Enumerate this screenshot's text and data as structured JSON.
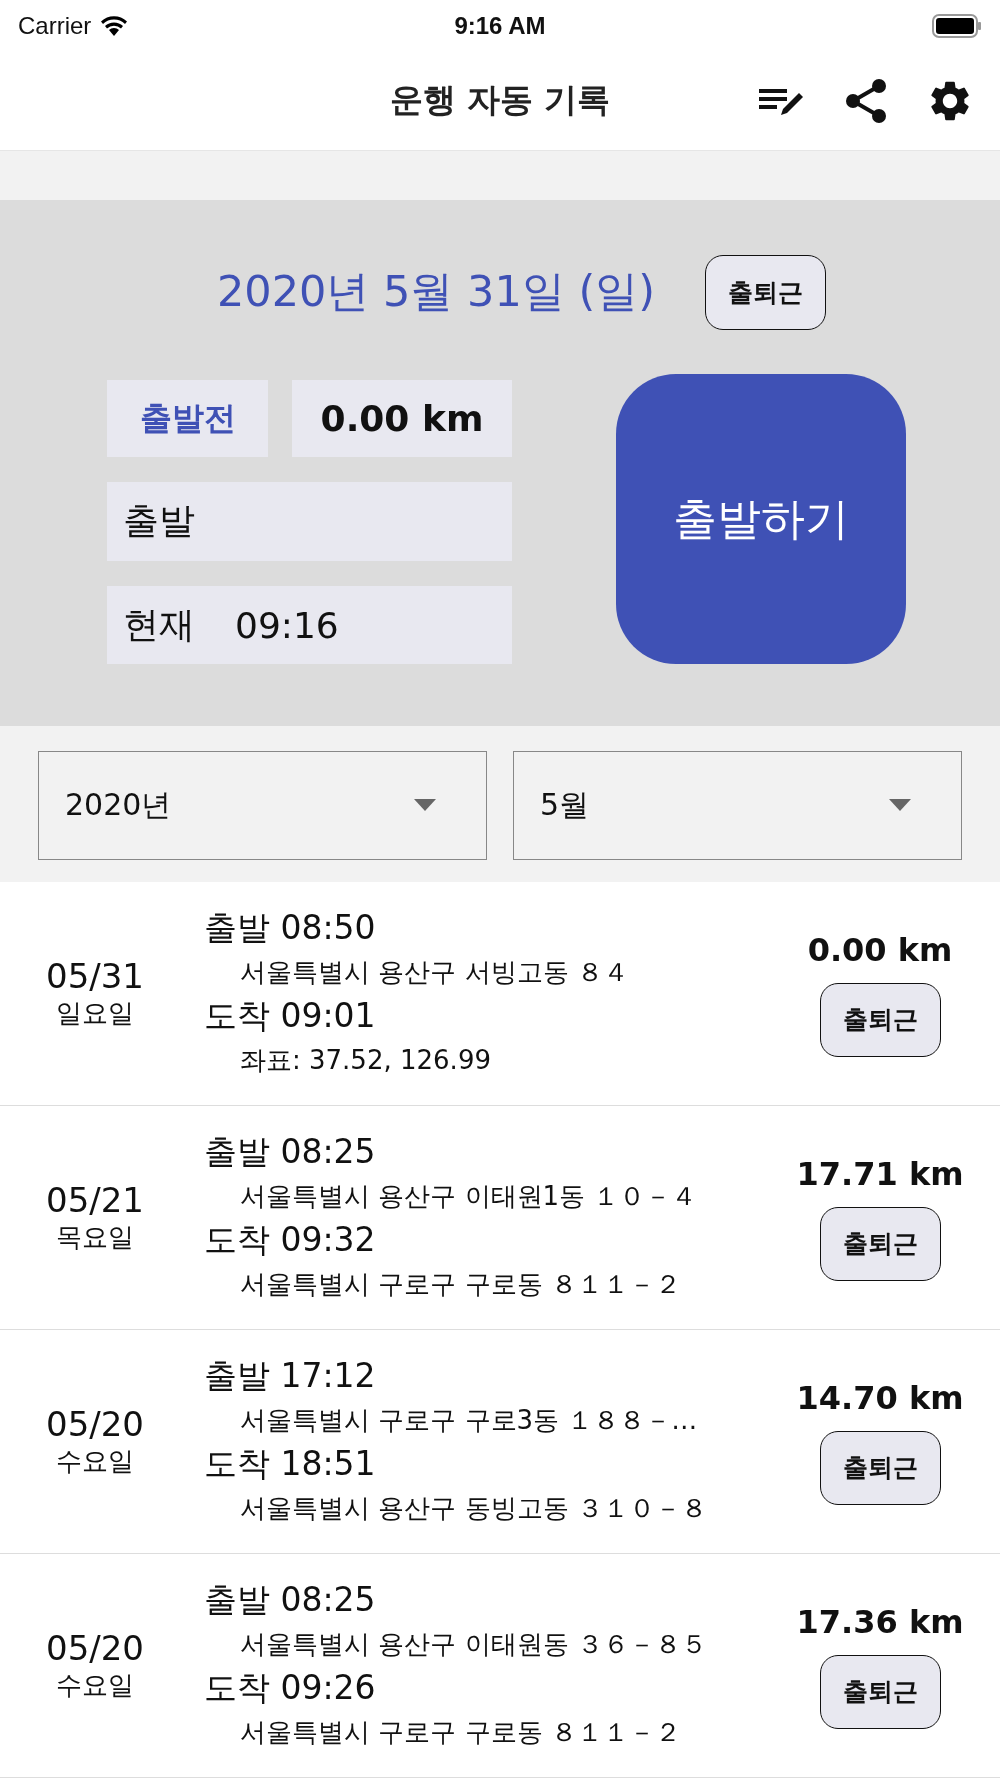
{
  "status_bar": {
    "carrier": "Carrier",
    "time": "9:16 AM"
  },
  "nav": {
    "title": "운행 자동 기록"
  },
  "today": {
    "date": "2020년 5월 31일 (일)",
    "category": "출퇴근",
    "state": "출발전",
    "distance": "0.00 km",
    "departure": "출발",
    "current_label": "현재",
    "current_time": "09:16",
    "start_button": "출발하기"
  },
  "filters": [
    {
      "value": "2020년"
    },
    {
      "value": "5월"
    }
  ],
  "trips": [
    {
      "date": "05/31",
      "weekday": "일요일",
      "depart": "출발 08:50",
      "depart_place": "서울특별시 용산구 서빙고동 ８４",
      "arrive": "도착 09:01",
      "arrive_place": "좌표: 37.52, 126.99",
      "distance": "0.00 km",
      "category": "출퇴근"
    },
    {
      "date": "05/21",
      "weekday": "목요일",
      "depart": "출발 08:25",
      "depart_place": "서울특별시 용산구 이태원1동 １０－４",
      "arrive": "도착 09:32",
      "arrive_place": "서울특별시 구로구 구로동 ８１１－２",
      "distance": "17.71 km",
      "category": "출퇴근"
    },
    {
      "date": "05/20",
      "weekday": "수요일",
      "depart": "출발 17:12",
      "depart_place": "서울특별시 구로구 구로3동 １８８－…",
      "arrive": "도착 18:51",
      "arrive_place": "서울특별시 용산구 동빙고동 ３１０－８",
      "distance": "14.70 km",
      "category": "출퇴근"
    },
    {
      "date": "05/20",
      "weekday": "수요일",
      "depart": "출발 08:25",
      "depart_place": "서울특별시 용산구 이태원동 ３６－８５",
      "arrive": "도착 09:26",
      "arrive_place": "서울특별시 구로구 구로동 ８１１－２",
      "distance": "17.36 km",
      "category": "출퇴근"
    }
  ]
}
